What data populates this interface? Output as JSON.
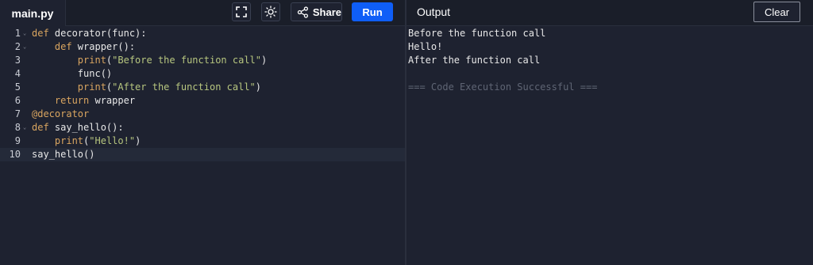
{
  "editor": {
    "file_name": "main.py",
    "share_label": "Share",
    "run_label": "Run",
    "icons": {
      "fullscreen": "fullscreen-icon",
      "theme": "sun-icon",
      "share": "share-icon"
    },
    "lines": [
      {
        "num": "1",
        "fold": "⌄",
        "tokens": [
          {
            "t": "def",
            "c": "kw"
          },
          {
            "t": " decorator(func):",
            "c": "fn"
          }
        ]
      },
      {
        "num": "2",
        "fold": "⌄",
        "tokens": [
          {
            "t": "    def",
            "c": "kw"
          },
          {
            "t": " wrapper():",
            "c": "fn"
          }
        ]
      },
      {
        "num": "3",
        "fold": "",
        "tokens": [
          {
            "t": "        print",
            "c": "kw"
          },
          {
            "t": "(",
            "c": "fn"
          },
          {
            "t": "\"Before the function call\"",
            "c": "str"
          },
          {
            "t": ")",
            "c": "fn"
          }
        ]
      },
      {
        "num": "4",
        "fold": "",
        "tokens": [
          {
            "t": "        func()",
            "c": "fn"
          }
        ]
      },
      {
        "num": "5",
        "fold": "",
        "tokens": [
          {
            "t": "        print",
            "c": "kw"
          },
          {
            "t": "(",
            "c": "fn"
          },
          {
            "t": "\"After the function call\"",
            "c": "str"
          },
          {
            "t": ")",
            "c": "fn"
          }
        ]
      },
      {
        "num": "6",
        "fold": "",
        "tokens": [
          {
            "t": "    return",
            "c": "kw"
          },
          {
            "t": " wrapper",
            "c": "fn"
          }
        ]
      },
      {
        "num": "7",
        "fold": "",
        "tokens": [
          {
            "t": "@decorator",
            "c": "kw"
          }
        ]
      },
      {
        "num": "8",
        "fold": "⌄",
        "tokens": [
          {
            "t": "def",
            "c": "kw"
          },
          {
            "t": " say_hello():",
            "c": "fn"
          }
        ]
      },
      {
        "num": "9",
        "fold": "",
        "tokens": [
          {
            "t": "    print",
            "c": "kw"
          },
          {
            "t": "(",
            "c": "fn"
          },
          {
            "t": "\"Hello!\"",
            "c": "str"
          },
          {
            "t": ")",
            "c": "fn"
          }
        ]
      },
      {
        "num": "10",
        "fold": "",
        "tokens": [
          {
            "t": "say_hello()",
            "c": "fn"
          }
        ],
        "active": true
      }
    ]
  },
  "output": {
    "title": "Output",
    "clear_label": "Clear",
    "lines": [
      {
        "text": "Before the function call",
        "style": ""
      },
      {
        "text": "Hello!",
        "style": ""
      },
      {
        "text": "After the function call",
        "style": ""
      },
      {
        "text": "",
        "style": ""
      },
      {
        "text": "=== Code Execution Successful ===",
        "style": "muted"
      }
    ]
  },
  "colors": {
    "background": "#1e2230",
    "header": "#1a1e29",
    "run_button": "#0f5ef7",
    "keyword": "#d9a560",
    "string": "#b7c67f"
  }
}
